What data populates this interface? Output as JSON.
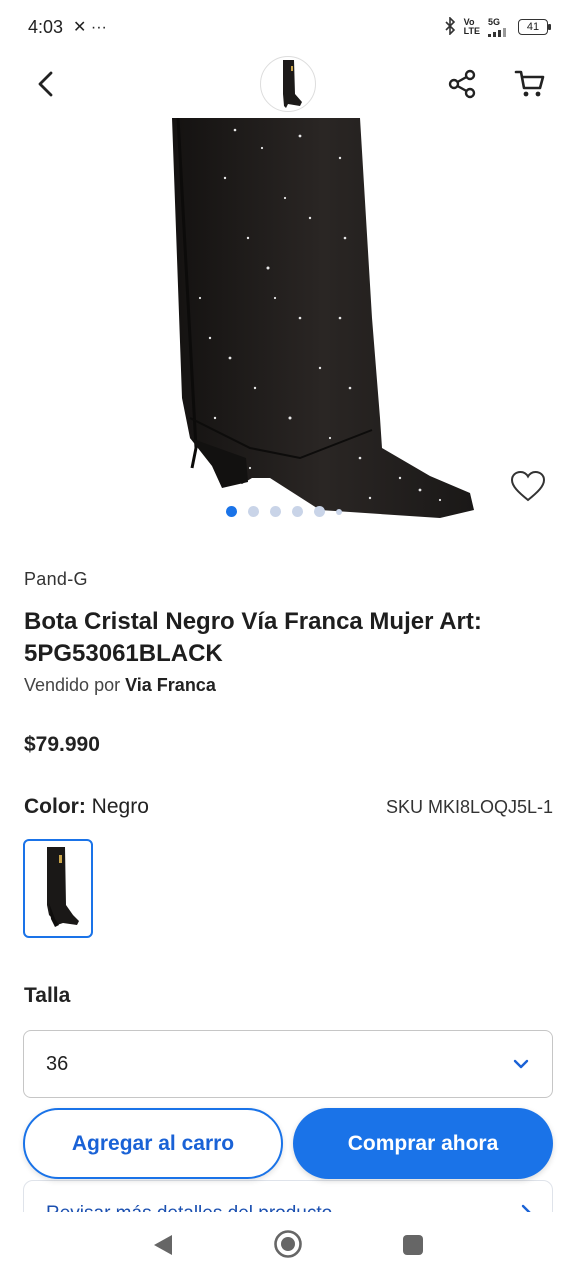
{
  "status_bar": {
    "time": "4:03",
    "left_icons": "✕ ···",
    "net_top": "Vo",
    "net_bottom": "LTE",
    "signal": "5G",
    "battery": "41"
  },
  "header": {
    "back_icon": "chevron-left-icon",
    "share_icon": "share-icon",
    "cart_icon": "cart-icon"
  },
  "gallery": {
    "dot_count": 6,
    "active_index": 0,
    "favorite_icon": "heart-outline-icon"
  },
  "product": {
    "brand": "Pand-G",
    "title": "Bota Cristal Negro Vía Franca Mujer Art: 5PG53061BLACK",
    "sold_by_prefix": "Vendido por",
    "seller": "Via Franca",
    "price": "$79.990",
    "color_label": "Color:",
    "color_value": "Negro",
    "sku": "SKU MKI8LOQJ5L-1"
  },
  "size": {
    "label": "Talla",
    "selected": "36"
  },
  "details": {
    "link_text": "Revisar más detalles del producto"
  },
  "actions": {
    "add_to_cart": "Agregar al carro",
    "buy_now": "Comprar ahora"
  },
  "colors": {
    "accent": "#1a73e8",
    "text_dark": "#222222"
  }
}
